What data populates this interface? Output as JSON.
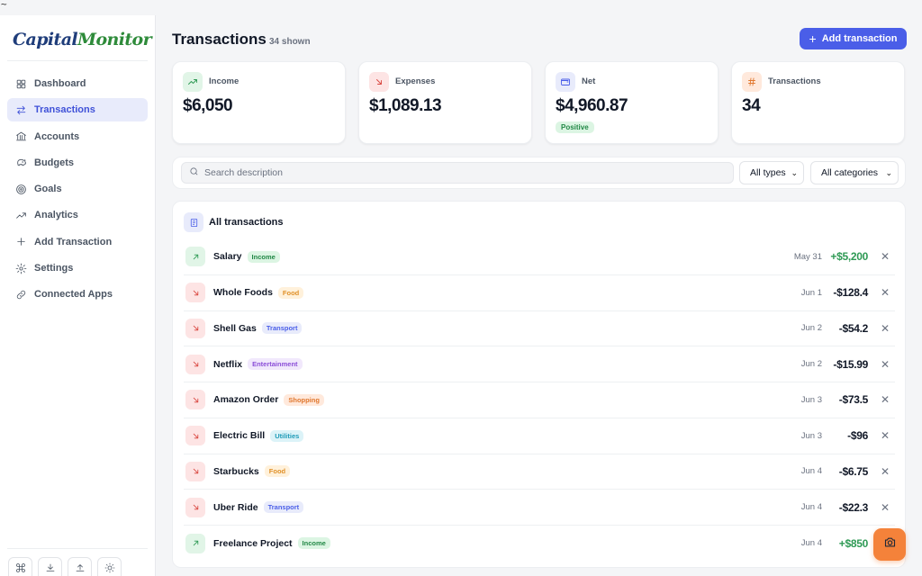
{
  "corner_text": "~",
  "brand": {
    "part1": "Capital",
    "part2": "Monitor"
  },
  "sidebar": {
    "items": [
      {
        "label": "Dashboard",
        "icon": "grid-icon",
        "active": false
      },
      {
        "label": "Transactions",
        "icon": "arrows-swap-icon",
        "active": true
      },
      {
        "label": "Accounts",
        "icon": "bank-icon",
        "active": false
      },
      {
        "label": "Budgets",
        "icon": "piggy-bank-icon",
        "active": false
      },
      {
        "label": "Goals",
        "icon": "target-icon",
        "active": false
      },
      {
        "label": "Analytics",
        "icon": "trend-line-icon",
        "active": false
      },
      {
        "label": "Add Transaction",
        "icon": "plus-icon",
        "active": false
      },
      {
        "label": "Settings",
        "icon": "gear-icon",
        "active": false
      },
      {
        "label": "Connected Apps",
        "icon": "link-icon",
        "active": false
      }
    ],
    "bottom_buttons": [
      "command-icon",
      "download-icon",
      "upload-icon",
      "sun-icon"
    ]
  },
  "header": {
    "title": "Transactions",
    "count_label": "34 shown",
    "add_button": "Add transaction"
  },
  "stats": {
    "income": {
      "label": "Income",
      "value": "$6,050"
    },
    "expenses": {
      "label": "Expenses",
      "value": "$1,089.13"
    },
    "net": {
      "label": "Net",
      "value": "$4,960.87",
      "badge": "Positive"
    },
    "count": {
      "label": "Transactions",
      "value": "34"
    }
  },
  "filters": {
    "search_placeholder": "Search description",
    "type_select": "All types",
    "category_select": "All categories"
  },
  "list": {
    "title": "All transactions",
    "rows": [
      {
        "name": "Salary",
        "category": "Income",
        "date": "May 31",
        "amount": "+$5,200",
        "direction": "in"
      },
      {
        "name": "Whole Foods",
        "category": "Food",
        "date": "Jun 1",
        "amount": "-$128.4",
        "direction": "out"
      },
      {
        "name": "Shell Gas",
        "category": "Transport",
        "date": "Jun 2",
        "amount": "-$54.2",
        "direction": "out"
      },
      {
        "name": "Netflix",
        "category": "Entertainment",
        "date": "Jun 2",
        "amount": "-$15.99",
        "direction": "out"
      },
      {
        "name": "Amazon Order",
        "category": "Shopping",
        "date": "Jun 3",
        "amount": "-$73.5",
        "direction": "out"
      },
      {
        "name": "Electric Bill",
        "category": "Utilities",
        "date": "Jun 3",
        "amount": "-$96",
        "direction": "out"
      },
      {
        "name": "Starbucks",
        "category": "Food",
        "date": "Jun 4",
        "amount": "-$6.75",
        "direction": "out"
      },
      {
        "name": "Uber Ride",
        "category": "Transport",
        "date": "Jun 4",
        "amount": "-$22.3",
        "direction": "out"
      },
      {
        "name": "Freelance Project",
        "category": "Income",
        "date": "Jun 4",
        "amount": "+$850",
        "direction": "in"
      }
    ]
  },
  "category_colors": {
    "Income": {
      "bg": "#dcf5e3",
      "fg": "#228846"
    },
    "Food": {
      "bg": "#fff1db",
      "fg": "#e0912a"
    },
    "Transport": {
      "bg": "#e8ebfb",
      "fg": "#4a5ee8"
    },
    "Entertainment": {
      "bg": "#f1e8fc",
      "fg": "#8b4ed8"
    },
    "Shopping": {
      "bg": "#ffe9dc",
      "fg": "#e0772e"
    },
    "Utilities": {
      "bg": "#dcf3f8",
      "fg": "#1f9bb8"
    }
  },
  "colors": {
    "accent": "#4a5ee8",
    "positive": "#2f9a55",
    "negative": "#d9463f",
    "fab": "#f4823a"
  }
}
